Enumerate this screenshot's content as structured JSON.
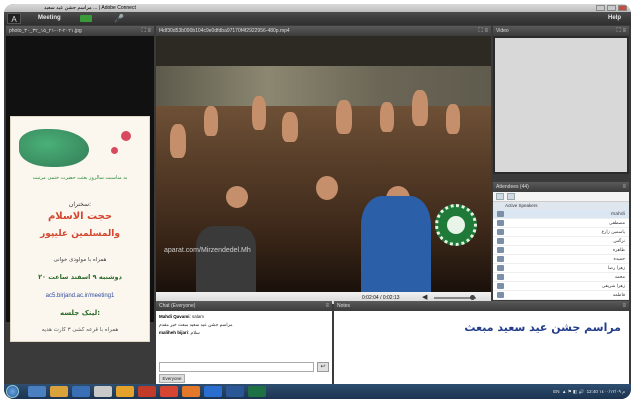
{
  "window": {
    "title": "مراسم جشن عيد سعيد ... | Adobe Connect"
  },
  "menu": {
    "logo": "A",
    "meeting": "Meeting",
    "help": "Help"
  },
  "photo_pod": {
    "title": "photo_٢٠٢١-٠٢-٢١_١٥_٣٢_٣٠.jpg",
    "poster": {
      "line1": "به مناسبت سالروز بعثت حضرت ختمی مرتبت",
      "line2": "سخنران:",
      "line3": "حجت الاسلام",
      "line4": "والمسلمین علیپور",
      "line5": "همراه با مولودی خوانی",
      "line6": "دوشنبه ۹ اسفند ساعت ۲۰",
      "link": "ac5.birjand.ac.ir/meeting1",
      "line8": "لینک جلسه:",
      "line9": "همراه با قرعه کشی ۳ کارت هدیه"
    }
  },
  "video_pod": {
    "title": "f4df30d53b090b104c9e0dfdba97170f4f2922956-480p.mp4",
    "watermark": "aparat.com/Mirzendedel.Mh",
    "time": "0:02:04 / 0:02:13",
    "volume_level": 0.85
  },
  "webcam_pod": {
    "title": "Video"
  },
  "attendees": {
    "title": "Attendees (44)",
    "section": "Active Speakers",
    "rows": [
      "mahdi",
      "مصطفی",
      "یاسمین زارع",
      "نرگس",
      "طاهره",
      "حمیده",
      "زهرا رضا",
      "محمد",
      "زهرا شریفی",
      "فاطمه"
    ]
  },
  "chat": {
    "title": "Chat",
    "scope": "(Everyone)",
    "messages": [
      {
        "name": "Mahdi Qavami",
        "text": "salam"
      },
      {
        "name": "",
        "text": "مراسم جشن عید سعید مبعث خیر مقدم"
      },
      {
        "name": "maliheh bijari",
        "text": "سلام"
      }
    ],
    "send": "↩",
    "tab": "Everyone"
  },
  "notes": {
    "title": "Notes",
    "text": "مراسم جشن عيد سعيد مبعث"
  },
  "taskbar": {
    "lang": "EN",
    "time": "12:40 م",
    "date": "١٤٠٠/١٢/٠٩"
  }
}
